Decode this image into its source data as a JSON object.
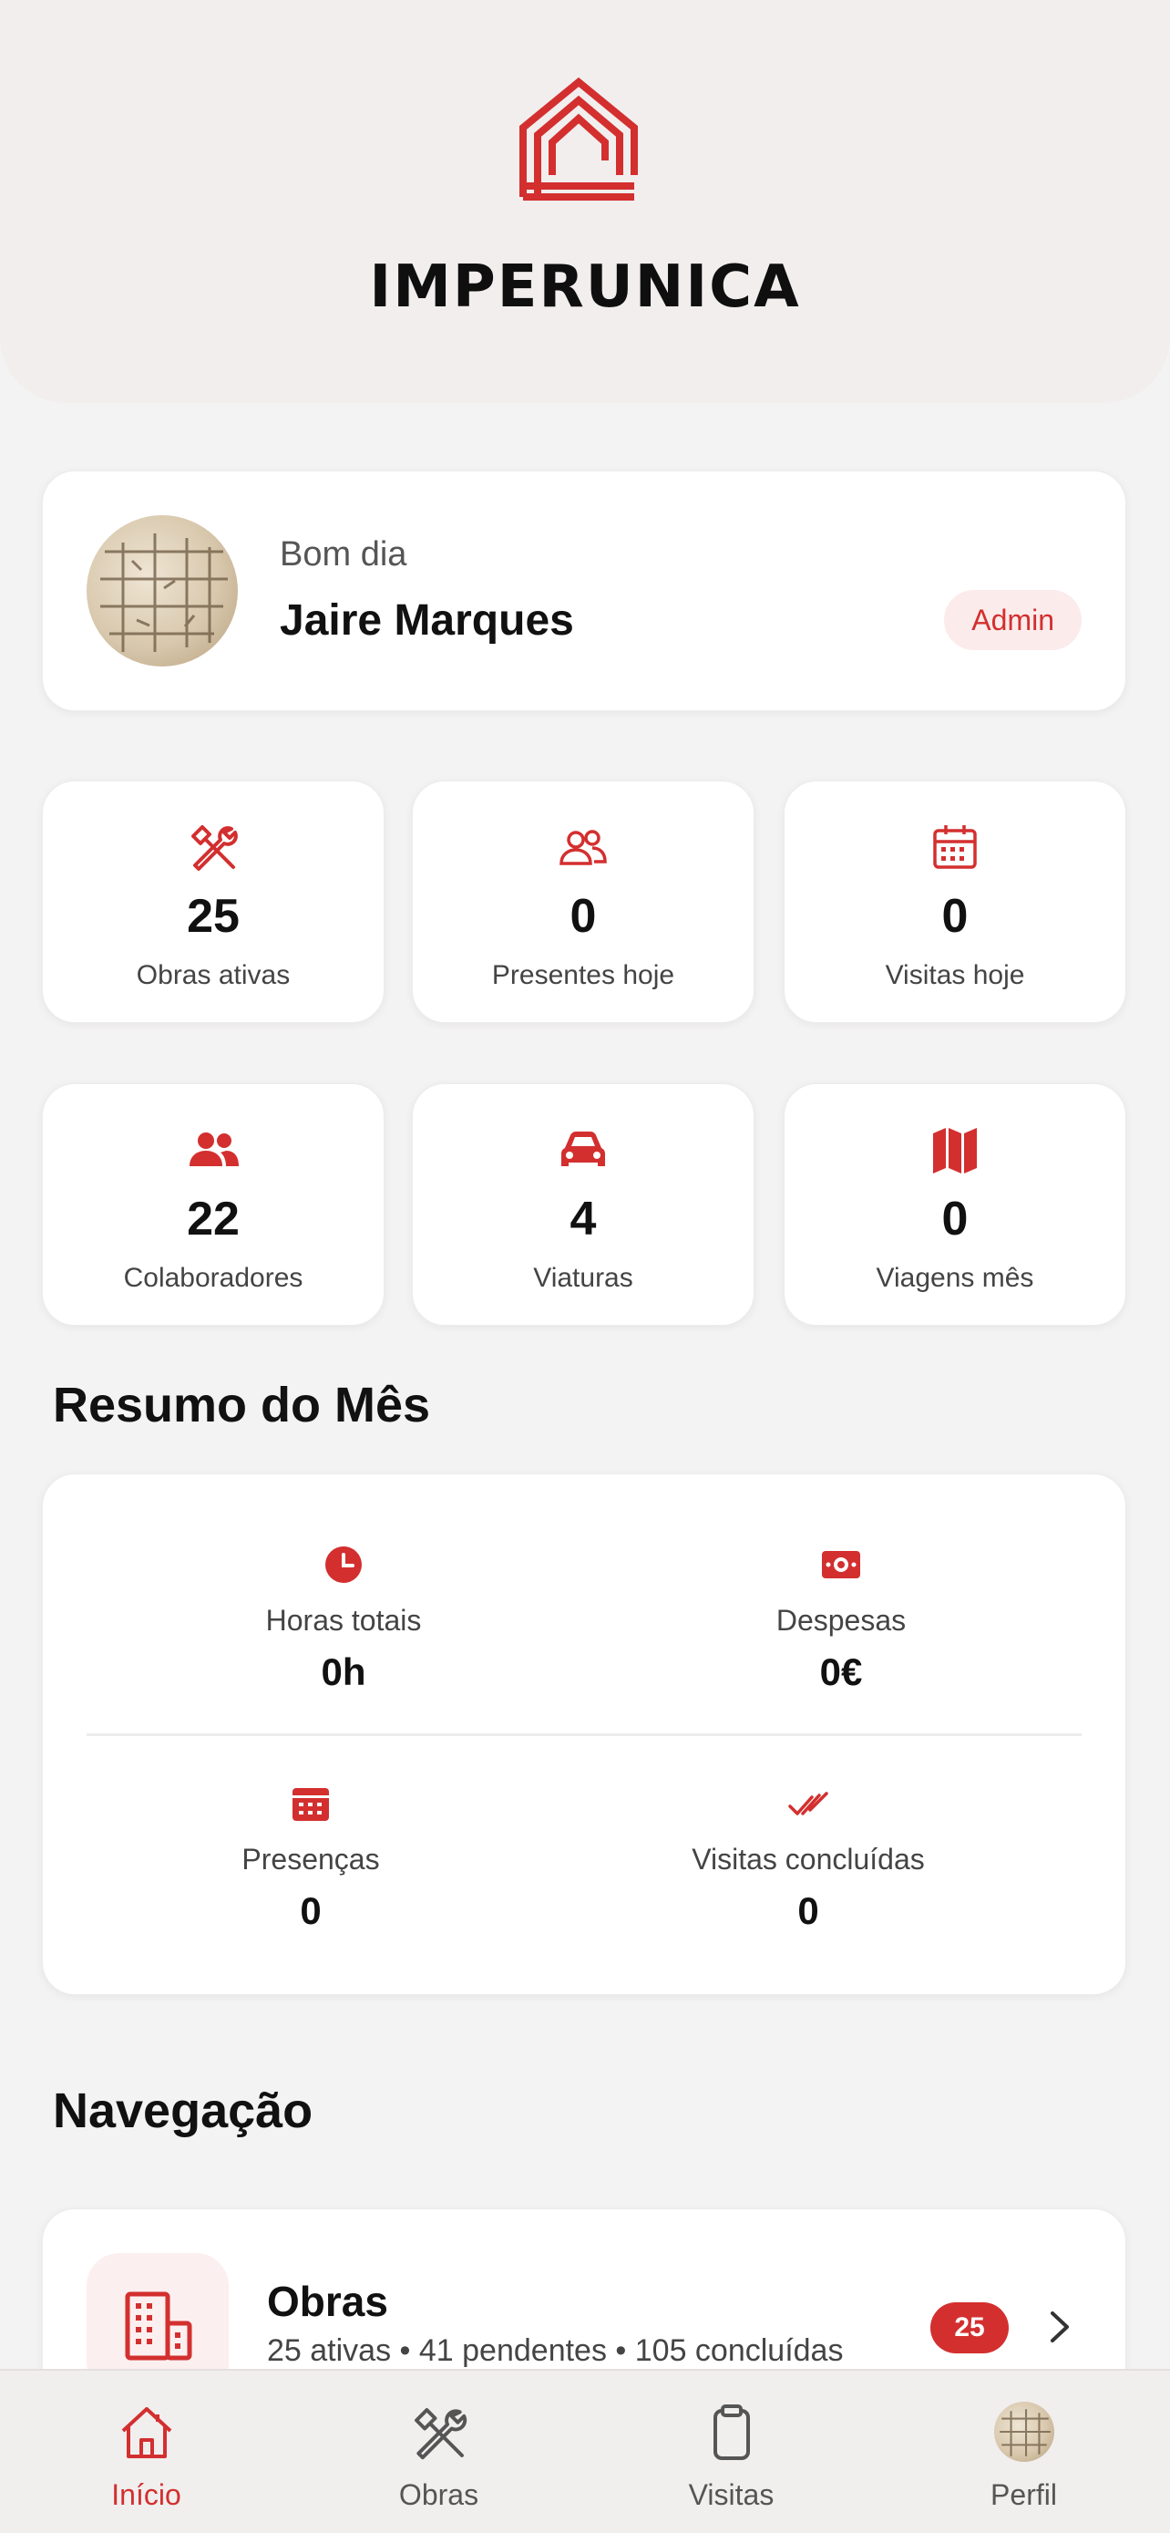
{
  "app": {
    "brand": "IMPERUNICA"
  },
  "profile": {
    "greeting": "Bom dia",
    "name": "Jaire Marques",
    "role": "Admin"
  },
  "stats": [
    {
      "icon": "tools-icon",
      "value": "25",
      "label": "Obras ativas"
    },
    {
      "icon": "people-outline-icon",
      "value": "0",
      "label": "Presentes hoje"
    },
    {
      "icon": "calendar-icon",
      "value": "0",
      "label": "Visitas hoje"
    },
    {
      "icon": "people-icon",
      "value": "22",
      "label": "Colaboradores"
    },
    {
      "icon": "car-icon",
      "value": "4",
      "label": "Viaturas"
    },
    {
      "icon": "map-icon",
      "value": "0",
      "label": "Viagens mês"
    }
  ],
  "summary": {
    "title": "Resumo do Mês",
    "items": [
      {
        "icon": "clock-icon",
        "label": "Horas totais",
        "value": "0h"
      },
      {
        "icon": "money-icon",
        "label": "Despesas",
        "value": "0€"
      },
      {
        "icon": "calendar-grid-icon",
        "label": "Presenças",
        "value": "0"
      },
      {
        "icon": "double-check-icon",
        "label": "Visitas concluídas",
        "value": "0"
      }
    ]
  },
  "navigation": {
    "title": "Navegação",
    "items": [
      {
        "icon": "building-icon",
        "title": "Obras",
        "subtitle": "25 ativas • 41 pendentes • 105 concluídas",
        "badge": "25"
      }
    ]
  },
  "tabs": [
    {
      "label": "Início",
      "icon": "home-icon",
      "active": true
    },
    {
      "label": "Obras",
      "icon": "tools-icon",
      "active": false
    },
    {
      "label": "Visitas",
      "icon": "clipboard-icon",
      "active": false
    },
    {
      "label": "Perfil",
      "icon": "avatar",
      "active": false
    }
  ],
  "colors": {
    "accent": "#d32f2f",
    "background": "#f4f3f3",
    "header": "#f2eeee"
  }
}
